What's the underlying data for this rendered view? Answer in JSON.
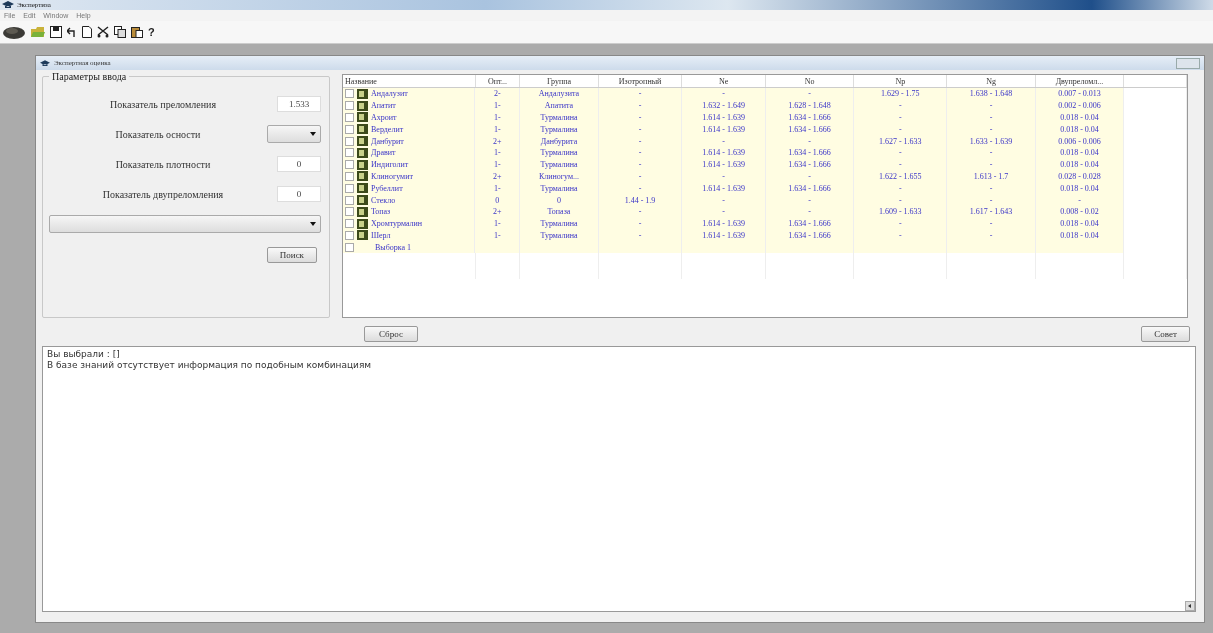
{
  "window": {
    "title": "Экспертиза"
  },
  "menu": [
    "File",
    "Edit",
    "Window",
    "Help"
  ],
  "toolbar": [
    {
      "kind": "logo"
    },
    {
      "kind": "open"
    },
    {
      "kind": "save"
    },
    {
      "kind": "undo"
    },
    {
      "kind": "new"
    },
    {
      "kind": "cut"
    },
    {
      "kind": "copy"
    },
    {
      "kind": "paste"
    },
    {
      "kind": "help",
      "label": "?"
    }
  ],
  "child_window": {
    "title": "Экспертная оценка"
  },
  "input_panel": {
    "title": "Параметры ввода",
    "fields": [
      {
        "kind": "text",
        "label": "Показатель преломления",
        "value": "1.533"
      },
      {
        "kind": "select",
        "label": "Показатель осности"
      },
      {
        "kind": "text",
        "label": "Показатель плотности",
        "value": "0"
      },
      {
        "kind": "text",
        "label": "Показатель двупреломления",
        "value": "0"
      }
    ],
    "search_button": "Поиск"
  },
  "table": {
    "columns": [
      "Название",
      "Опт...",
      "Группа",
      "Изотропный",
      "Ne",
      "No",
      "Np",
      "Ng",
      "Двупреломл..."
    ],
    "rows": [
      {
        "kind": "mineral",
        "checked": false,
        "cells": [
          "Андалузит",
          "2-",
          "Андалузита",
          "-",
          "-",
          "-",
          "1.629 - 1.75",
          "1.638 - 1.648",
          "0.007 - 0.013"
        ]
      },
      {
        "kind": "mineral",
        "checked": false,
        "cells": [
          "Апатит",
          "1-",
          "Апатита",
          "-",
          "1.632 - 1.649",
          "1.628 - 1.648",
          "-",
          "-",
          "0.002 - 0.006"
        ]
      },
      {
        "kind": "mineral",
        "checked": false,
        "cells": [
          "Ахроит",
          "1-",
          "Турмалина",
          "-",
          "1.614 - 1.639",
          "1.634 - 1.666",
          "-",
          "-",
          "0.018 - 0.04"
        ]
      },
      {
        "kind": "mineral",
        "checked": false,
        "cells": [
          "Верделит",
          "1-",
          "Турмалина",
          "-",
          "1.614 - 1.639",
          "1.634 - 1.666",
          "-",
          "-",
          "0.018 - 0.04"
        ]
      },
      {
        "kind": "mineral",
        "checked": false,
        "cells": [
          "Данбурит",
          "2+",
          "Данбурита",
          "-",
          "-",
          "-",
          "1.627 - 1.633",
          "1.633 - 1.639",
          "0.006 - 0.006"
        ]
      },
      {
        "kind": "mineral",
        "checked": false,
        "cells": [
          "Дравит",
          "1-",
          "Турмалина",
          "-",
          "1.614 - 1.639",
          "1.634 - 1.666",
          "-",
          "-",
          "0.018 - 0.04"
        ]
      },
      {
        "kind": "mineral",
        "checked": false,
        "cells": [
          "Индиголит",
          "1-",
          "Турмалина",
          "-",
          "1.614 - 1.639",
          "1.634 - 1.666",
          "-",
          "-",
          "0.018 - 0.04"
        ]
      },
      {
        "kind": "mineral",
        "checked": false,
        "cells": [
          "Клиногумит",
          "2+",
          "Клиногум...",
          "-",
          "-",
          "-",
          "1.622 - 1.655",
          "1.613 - 1.7",
          "0.028 - 0.028"
        ]
      },
      {
        "kind": "mineral",
        "checked": false,
        "cells": [
          "Рубеллит",
          "1-",
          "Турмалина",
          "-",
          "1.614 - 1.639",
          "1.634 - 1.666",
          "-",
          "-",
          "0.018 - 0.04"
        ]
      },
      {
        "kind": "mineral",
        "checked": false,
        "cells": [
          "Стекло",
          "0",
          "0",
          "1.44 - 1.9",
          "-",
          "-",
          "-",
          "-",
          "-"
        ]
      },
      {
        "kind": "mineral",
        "checked": false,
        "cells": [
          "Топаз",
          "2+",
          "Топаза",
          "-",
          "-",
          "-",
          "1.609 - 1.633",
          "1.617 - 1.643",
          "0.008 - 0.02"
        ]
      },
      {
        "kind": "mineral",
        "checked": false,
        "cells": [
          "Хромтурмалин",
          "1-",
          "Турмалина",
          "-",
          "1.614 - 1.639",
          "1.634 - 1.666",
          "-",
          "-",
          "0.018 - 0.04"
        ]
      },
      {
        "kind": "mineral",
        "checked": false,
        "cells": [
          "Шерл",
          "1-",
          "Турмалина",
          "-",
          "1.614 - 1.639",
          "1.634 - 1.666",
          "-",
          "-",
          "0.018 - 0.04"
        ]
      },
      {
        "kind": "group",
        "checked": false,
        "cells": [
          "Выборка 1"
        ]
      }
    ]
  },
  "reset_button": "Сброс",
  "advice_button": "Совет",
  "output": [
    "Вы выбрали : []",
    "В базе знаний отсутствует информация по подобным комбинациям"
  ]
}
